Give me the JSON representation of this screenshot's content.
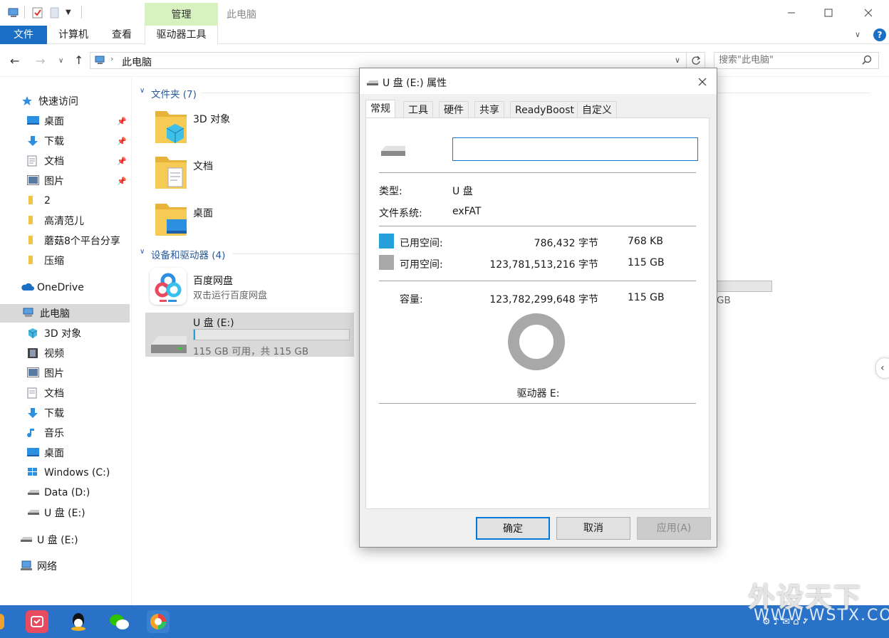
{
  "titlebar": {
    "manage_label": "管理",
    "title": "此电脑"
  },
  "ribbon": {
    "tabs": [
      "文件",
      "计算机",
      "查看",
      "驱动器工具"
    ]
  },
  "address": {
    "path": "此电脑",
    "search_placeholder": "搜索\"此电脑\""
  },
  "sidebar": {
    "quick_access": "快速访问",
    "items_pinned": [
      "桌面",
      "下载",
      "文档",
      "图片"
    ],
    "items_folders": [
      "2",
      "高清范儿",
      "蘑菇8个平台分享",
      "压缩"
    ],
    "onedrive": "OneDrive",
    "this_pc": "此电脑",
    "pc_items": [
      "3D 对象",
      "视频",
      "图片",
      "文档",
      "下载",
      "音乐",
      "桌面",
      "Windows (C:)",
      "Data (D:)",
      "U 盘 (E:)"
    ],
    "usb": "U 盘 (E:)",
    "network": "网络"
  },
  "main": {
    "folders_header": "文件夹 (7)",
    "folders": [
      "3D 对象",
      "文档",
      "桌面"
    ],
    "devices_header": "设备和驱动器 (4)",
    "baidu_name": "百度网盘",
    "baidu_desc": "双击运行百度网盘",
    "usb_name": "U 盘 (E:)",
    "usb_free": "115 GB 可用，共 115 GB",
    "usb_fill": 0.01,
    "hidden_drive_text": "GB"
  },
  "dialog": {
    "title": "U 盘 (E:) 属性",
    "tabs": [
      "常规",
      "工具",
      "硬件",
      "共享",
      "ReadyBoost",
      "自定义"
    ],
    "name_value": "",
    "type_label": "类型:",
    "type_value": "U 盘",
    "fs_label": "文件系统:",
    "fs_value": "exFAT",
    "used_label": "已用空间:",
    "used_bytes": "786,432 字节",
    "used_size": "768 KB",
    "free_label": "可用空间:",
    "free_bytes": "123,781,513,216 字节",
    "free_size": "115 GB",
    "cap_label": "容量:",
    "cap_bytes": "123,782,299,648 字节",
    "cap_size": "115 GB",
    "drive_label": "驱动器 E:",
    "used_fraction": 6.4e-06,
    "used_color": "#26a0da",
    "free_color": "#a8a8a8",
    "ok": "确定",
    "cancel": "取消",
    "apply": "应用(A)"
  },
  "watermark": {
    "line1": "外设天下",
    "line2": "WWW.WSTX.COM"
  }
}
